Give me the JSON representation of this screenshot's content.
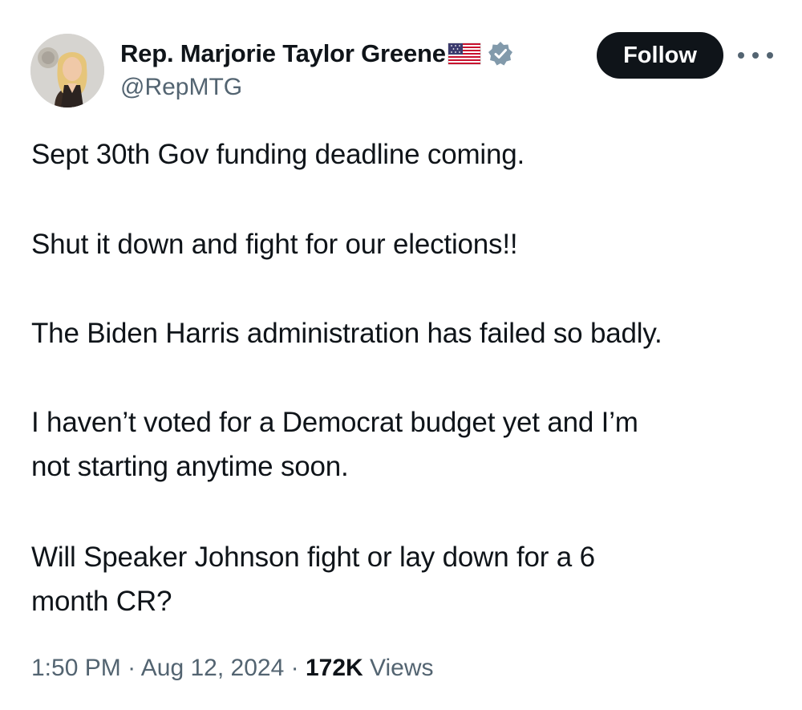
{
  "author": {
    "display_name": "Rep. Marjorie Taylor Greene",
    "handle": "@RepMTG",
    "badge_icon": "verified-badge-icon",
    "flag_icon": "us-flag-icon",
    "avatar_icon": "profile-avatar"
  },
  "actions": {
    "follow_label": "Follow",
    "more_icon": "more-options-icon"
  },
  "tweet": {
    "lines": [
      "Sept 30th Gov funding deadline coming.",
      "Shut it down and fight for our elections!!",
      "The Biden Harris administration has failed so badly.",
      "I haven’t voted for a Democrat budget yet and I’m",
      "not starting anytime soon.",
      "Will Speaker Johnson fight or lay down for a 6",
      "month CR?"
    ]
  },
  "meta": {
    "time": "1:50 PM",
    "separator": "·",
    "date": "Aug 12, 2024",
    "views_count": "172K",
    "views_label": "Views"
  },
  "colors": {
    "text": "#0f1419",
    "secondary": "#536471",
    "follow_bg": "#0f1419",
    "verified": "#829aab"
  }
}
